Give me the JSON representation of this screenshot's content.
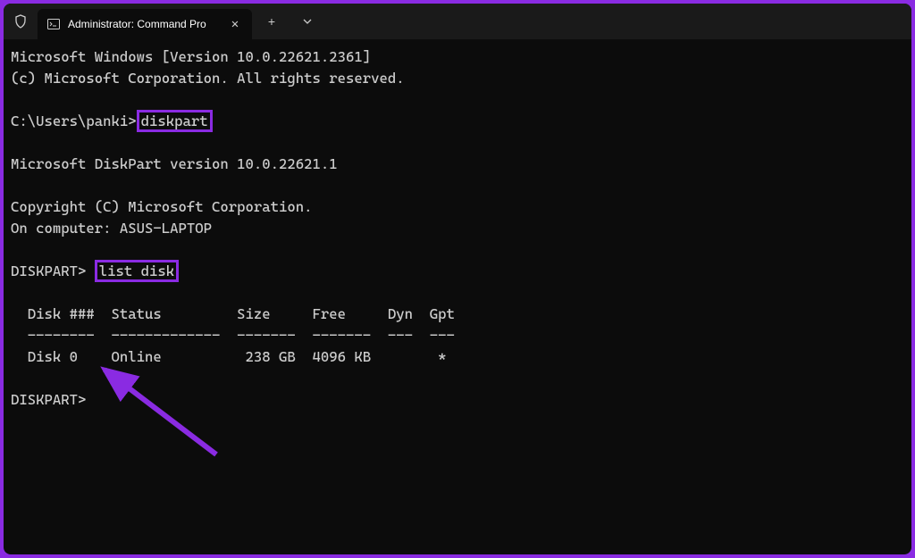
{
  "titlebar": {
    "tab_title": "Administrator: Command Pro"
  },
  "terminal": {
    "line1": "Microsoft Windows [Version 10.0.22621.2361]",
    "line2": "(c) Microsoft Corporation. All rights reserved.",
    "prompt1_prefix": "C:\\Users\\panki>",
    "prompt1_cmd": "diskpart",
    "diskpart_version": "Microsoft DiskPart version 10.0.22621.1",
    "copyright": "Copyright (C) Microsoft Corporation.",
    "on_computer": "On computer: ASUS-LAPTOP",
    "prompt2_prefix": "DISKPART> ",
    "prompt2_cmd": "list disk",
    "table_header": "  Disk ###  Status         Size     Free     Dyn  Gpt",
    "table_divider": "  --------  -------------  -------  -------  ---  ---",
    "table_row": "  Disk 0    Online          238 GB  4096 KB        *",
    "prompt3": "DISKPART>"
  },
  "colors": {
    "highlight": "#8a2be2",
    "terminal_bg": "#0c0c0c",
    "terminal_fg": "#cccccc"
  }
}
